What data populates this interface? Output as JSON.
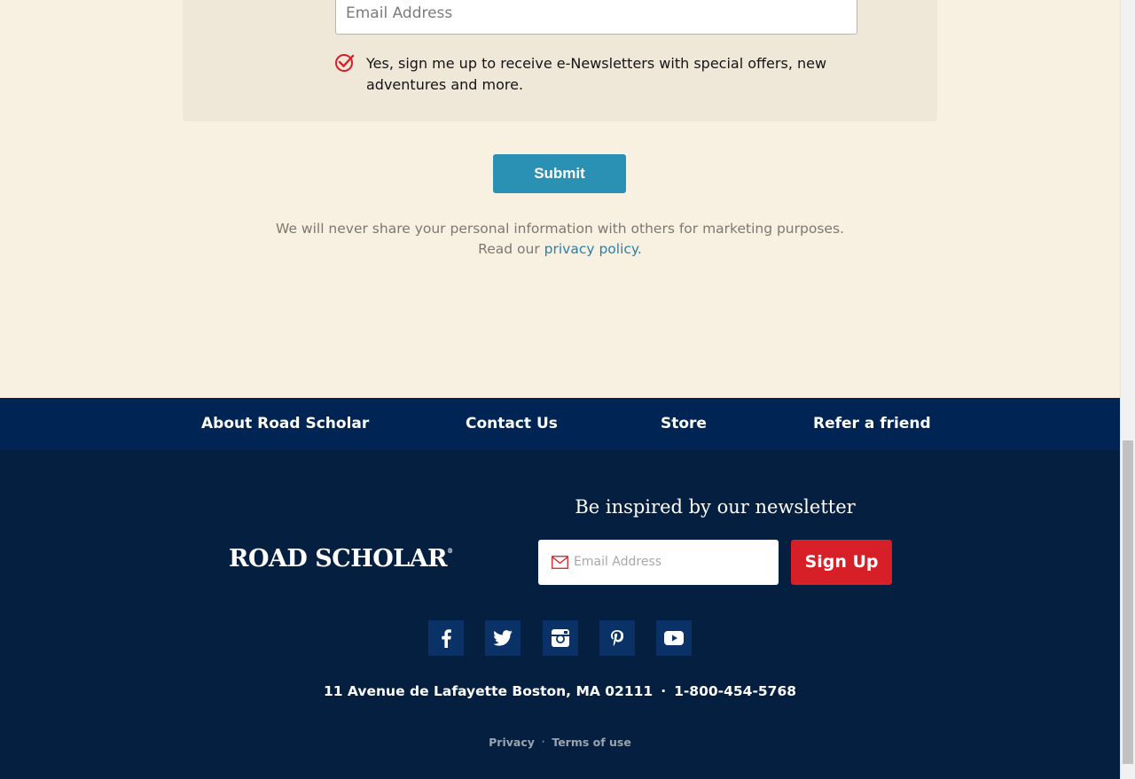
{
  "form": {
    "email_placeholder": "Email Address",
    "consent_text": "Yes, sign me up to receive e-Newsletters with special offers, new adventures and more.",
    "consent_checked": true,
    "submit_label": "Submit",
    "privacy_line1": "We will never share your personal information with others for marketing purposes.",
    "privacy_line2_prefix": "Read our ",
    "privacy_link": "privacy policy."
  },
  "nav": {
    "items": [
      "About Road Scholar",
      "Contact Us",
      "Store",
      "Refer a friend"
    ]
  },
  "footer": {
    "logo_text": "ROAD SCHOLAR",
    "logo_mark": "®",
    "newsletter_heading": "Be inspired by our newsletter",
    "newsletter_placeholder": "Email Address",
    "signup_label": "Sign Up",
    "social": [
      "facebook-icon",
      "twitter-icon",
      "instagram-icon",
      "pinterest-icon",
      "youtube-icon"
    ],
    "address": "11 Avenue de Lafayette Boston, MA 02111",
    "separator": "·",
    "phone": "1-800-454-5768",
    "legal": [
      "Privacy",
      "Terms of use"
    ]
  },
  "colors": {
    "page_bg": "#f8f1e2",
    "panel_bg": "#efe8d9",
    "submit": "#2a91b5",
    "nav_bg": "#002554",
    "footer_bg": "#051f40",
    "signup": "#d61f26",
    "check": "#d61f26"
  }
}
